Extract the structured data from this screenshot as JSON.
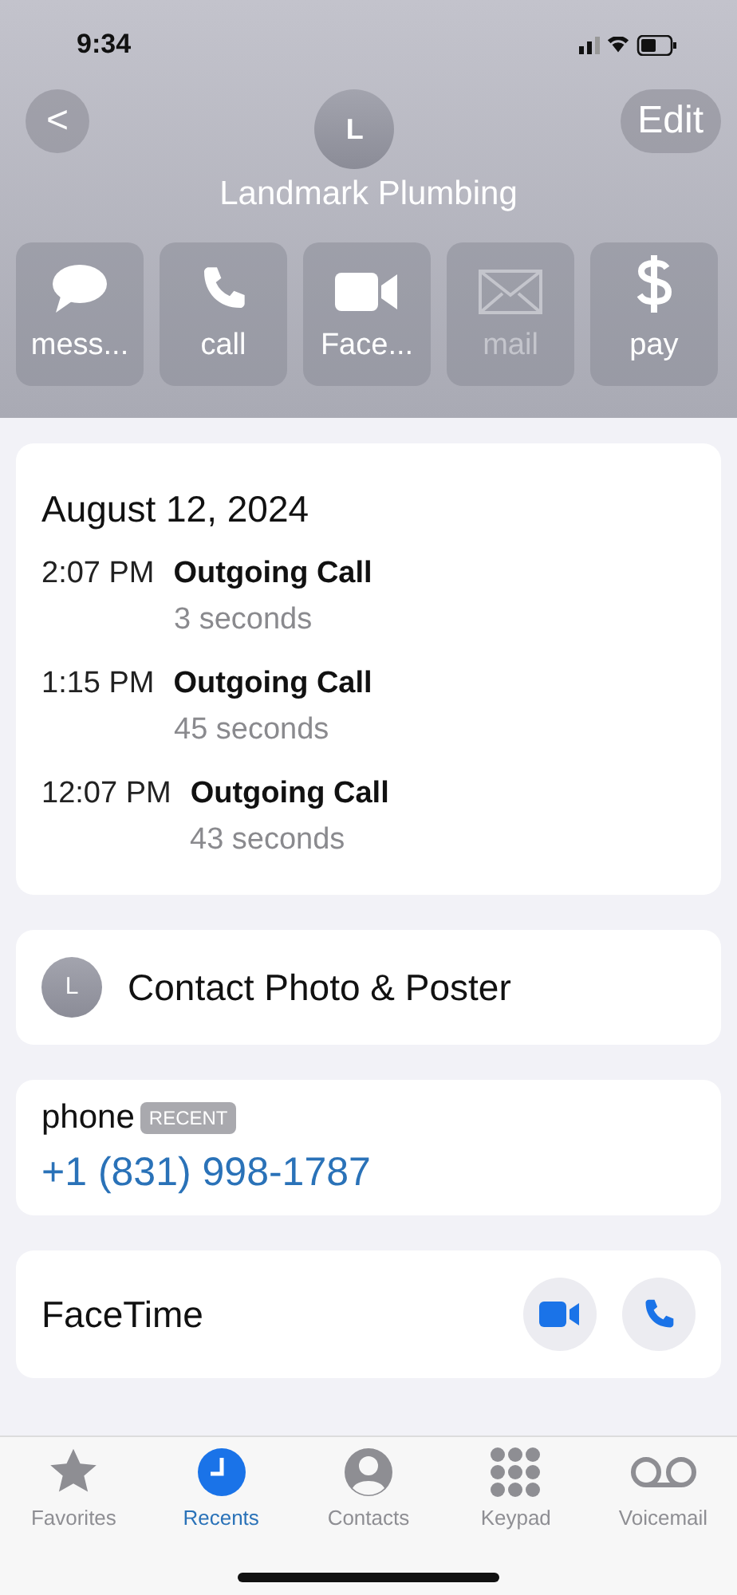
{
  "status_bar": {
    "time": "9:34"
  },
  "header": {
    "back": "<",
    "edit": "Edit",
    "avatar_initial": "L",
    "name": "Landmark Plumbing"
  },
  "actions": [
    {
      "kind": "message",
      "label": "mess...",
      "disabled": false
    },
    {
      "kind": "call",
      "label": "call",
      "disabled": false
    },
    {
      "kind": "video",
      "label": "Face...",
      "disabled": false
    },
    {
      "kind": "mail",
      "label": "mail",
      "disabled": true
    },
    {
      "kind": "pay",
      "label": "pay",
      "disabled": false
    }
  ],
  "call_history": {
    "date": "August 12, 2024",
    "calls": [
      {
        "time": "2:07 PM",
        "type": "Outgoing Call",
        "duration": "3 seconds"
      },
      {
        "time": "1:15 PM",
        "type": "Outgoing Call",
        "duration": "45 seconds"
      },
      {
        "time": "12:07 PM",
        "type": "Outgoing Call",
        "duration": "43 seconds"
      }
    ]
  },
  "contact_photo": {
    "initial": "L",
    "label": "Contact Photo & Poster"
  },
  "phone": {
    "label": "phone",
    "badge": "RECENT",
    "number": "+1 (831) 998-1787"
  },
  "facetime": {
    "label": "FaceTime"
  },
  "tabs": [
    {
      "kind": "favorites",
      "label": "Favorites",
      "selected": false
    },
    {
      "kind": "recents",
      "label": "Recents",
      "selected": true
    },
    {
      "kind": "contacts",
      "label": "Contacts",
      "selected": false
    },
    {
      "kind": "keypad",
      "label": "Keypad",
      "selected": false
    },
    {
      "kind": "voicemail",
      "label": "Voicemail",
      "selected": false
    }
  ]
}
